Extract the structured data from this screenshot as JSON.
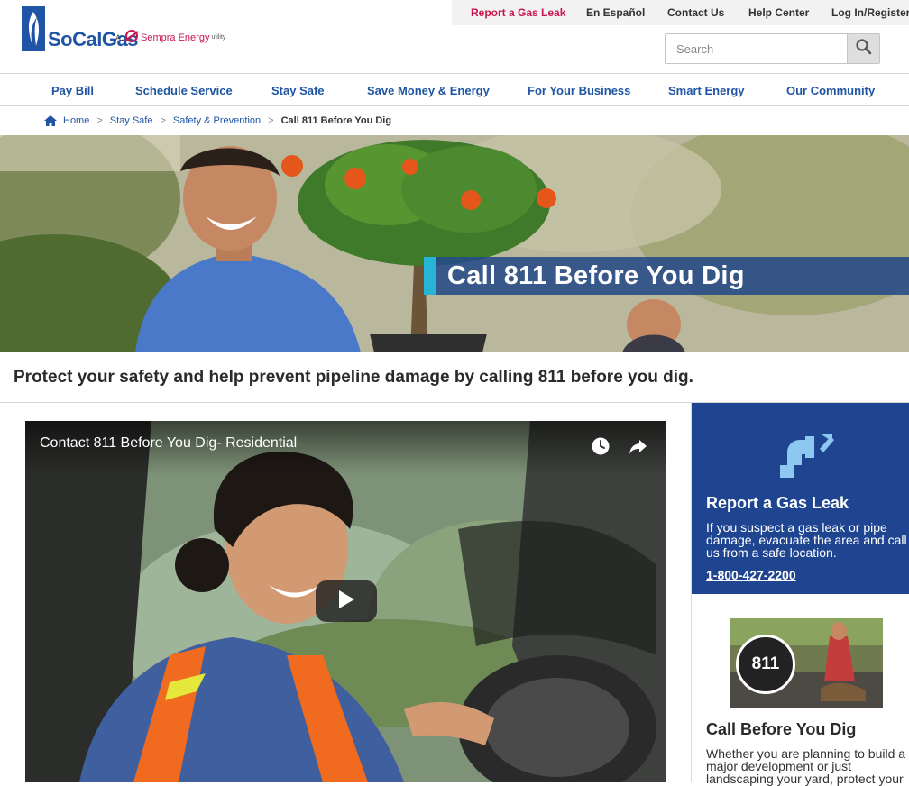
{
  "brand": {
    "name": "SoCalGas",
    "a": "A",
    "parent": "Sempra Energy",
    "utility": "utility",
    "colors": {
      "primary": "#1f55a4",
      "accent": "#c8174e",
      "cyan": "#27b5d6",
      "card": "#1f4591"
    }
  },
  "utility_nav": {
    "report_leak": "Report a Gas Leak",
    "espanol": "En Español",
    "contact": "Contact Us",
    "help": "Help Center",
    "login": "Log In/Register"
  },
  "search": {
    "placeholder": "Search",
    "icon": "search-icon"
  },
  "main_nav": [
    {
      "label": "Pay Bill"
    },
    {
      "label": "Schedule Service"
    },
    {
      "label": "Stay Safe"
    },
    {
      "label": "Save Money & Energy"
    },
    {
      "label": "For Your Business"
    },
    {
      "label": "Smart Energy"
    },
    {
      "label": "Our Community"
    }
  ],
  "breadcrumb": {
    "home": "Home",
    "items": [
      "Stay Safe",
      "Safety & Prevention"
    ],
    "current": "Call 811 Before You Dig",
    "separator": ">"
  },
  "hero": {
    "title": "Call 811 Before You Dig"
  },
  "intro": "Protect your safety and help prevent pipeline damage by calling 811 before you dig.",
  "video": {
    "title": "Contact 811 Before You Dig- Residential",
    "icons": [
      "clock-icon",
      "share-icon",
      "play-icon"
    ]
  },
  "sidebar": {
    "leak": {
      "title": "Report a Gas Leak",
      "text": "If you suspect a gas leak or pipe damage, evacuate the area and call us from a safe location.",
      "phone": "1-800-427-2200"
    },
    "dig": {
      "badge": "811",
      "title": "Call Before You Dig",
      "text": "Whether you are planning to build a major development or just landscaping your yard, protect your"
    }
  }
}
